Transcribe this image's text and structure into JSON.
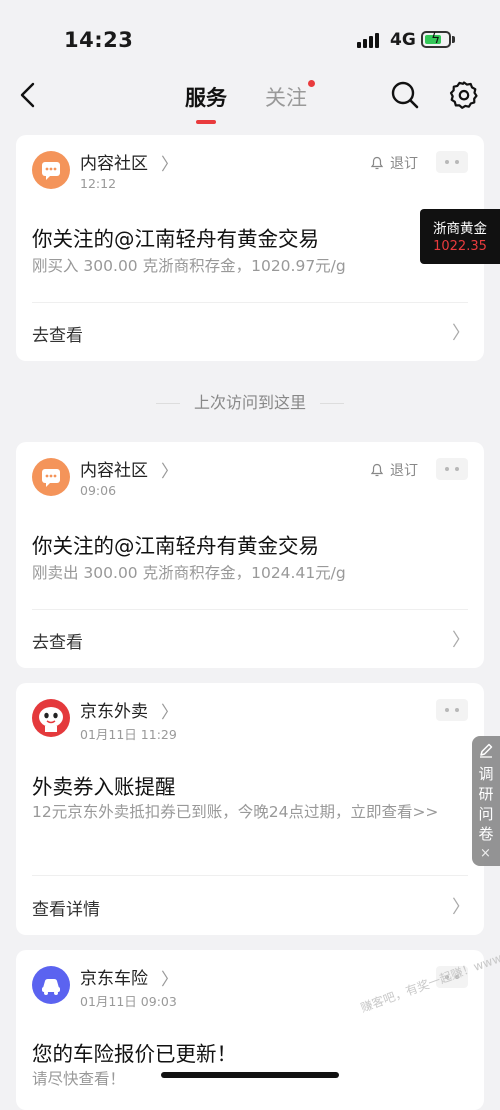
{
  "status_bar": {
    "time": "14:23",
    "network": "4G"
  },
  "nav": {
    "tab_services": "服务",
    "tab_follow": "关注"
  },
  "gold_badge": {
    "name": "浙商黄金",
    "price": "1022.35"
  },
  "visited_marker": "上次访问到这里",
  "cards": [
    {
      "source": "内容社区",
      "time": "12:12",
      "unsubscribe": "退订",
      "title": "你关注的@江南轻舟有黄金交易",
      "desc": "刚买入 300.00 克浙商积存金，1020.97元/g",
      "action": "去查看"
    },
    {
      "source": "内容社区",
      "time": "09:06",
      "unsubscribe": "退订",
      "title": "你关注的@江南轻舟有黄金交易",
      "desc": "刚卖出 300.00 克浙商积存金，1024.41元/g",
      "action": "去查看"
    },
    {
      "source": "京东外卖",
      "time": "01月11日 11:29",
      "title": "外卖券入账提醒",
      "desc": "12元京东外卖抵扣券已到账，今晚24点过期，立即查看>>",
      "action": "查看详情"
    },
    {
      "source": "京东车险",
      "time": "01月11日 09:03",
      "title": "您的车险报价已更新！",
      "desc": "请尽快查看！"
    }
  ],
  "survey": {
    "label": "调研问卷",
    "close": "×"
  },
  "watermark": "赚客吧，有奖一起赚！www.zuanke8.com",
  "colors": {
    "accent": "#e93b3d",
    "background": "#f2f2f4",
    "community_avatar": "#f4945a",
    "waimai_avatar": "#e4393c",
    "insurance_avatar": "#5b63f0"
  },
  "icons": [
    "back-arrow-icon",
    "search-icon",
    "gear-icon",
    "bell-icon",
    "more-dots-icon",
    "chevron-right-icon",
    "pen-icon",
    "close-icon"
  ]
}
